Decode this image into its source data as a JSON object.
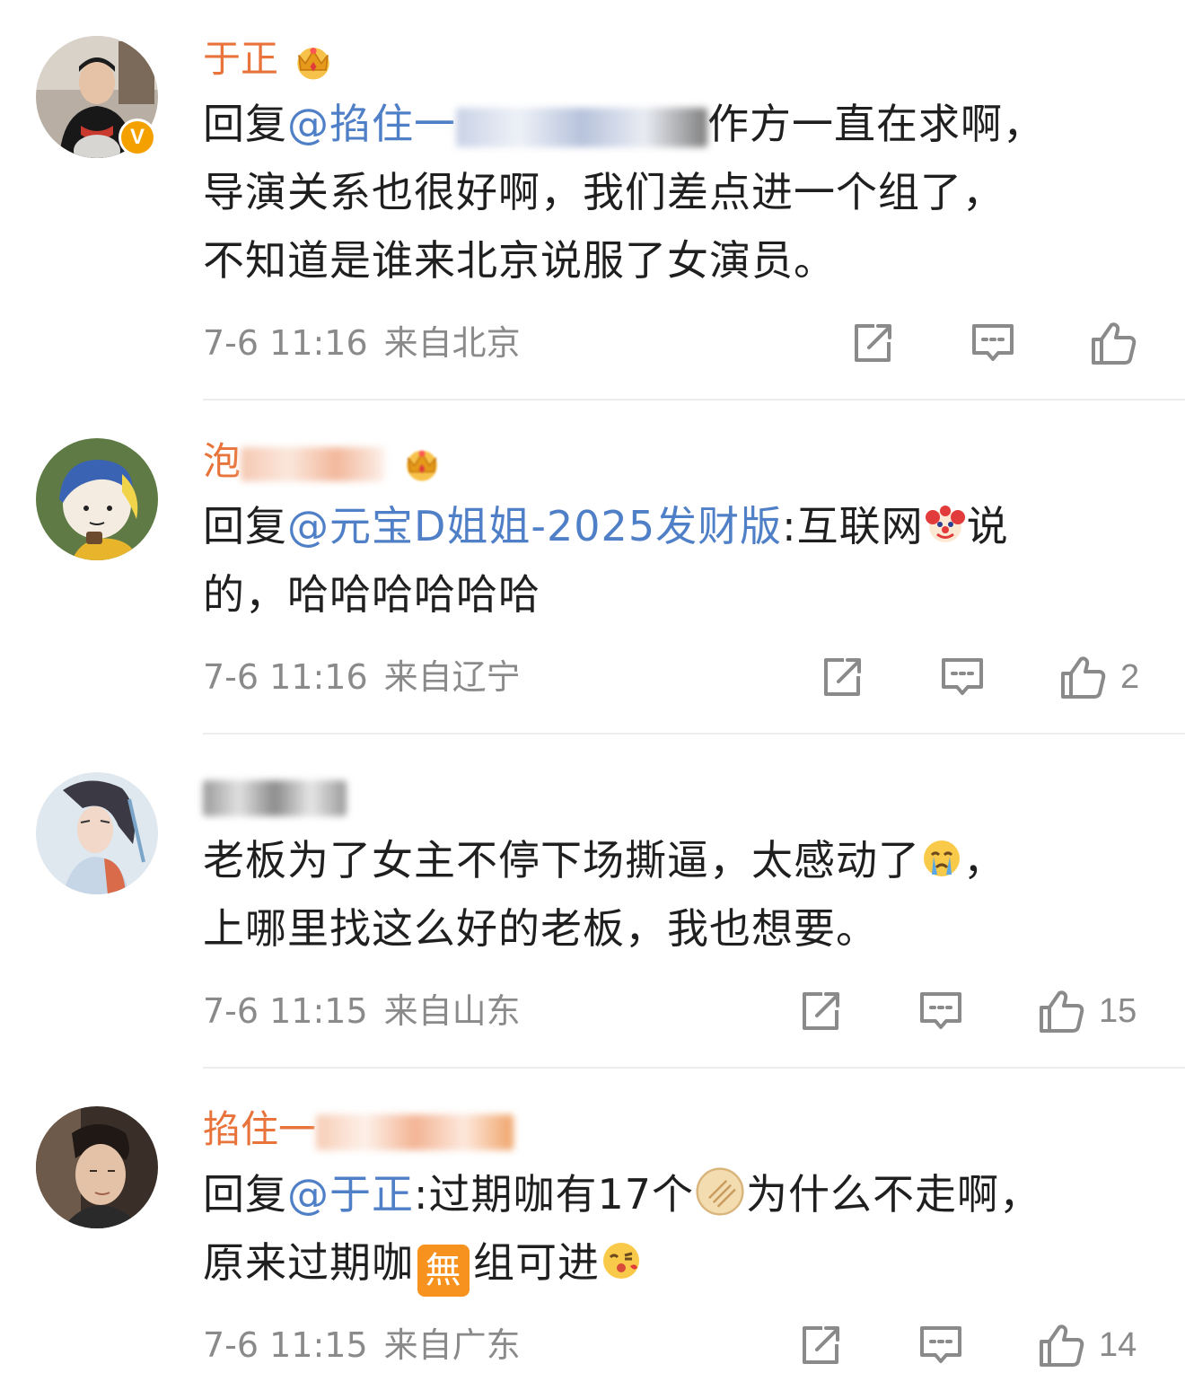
{
  "comments": [
    {
      "username": "于正",
      "line1_prefix": "回复",
      "line1_mention": "@掐住一",
      "line1_suffix": "作方一直在求啊，",
      "line2": "导演关系也很好啊，我们差点进一个组了，",
      "line3": "不知道是谁来北京说服了女演员。",
      "time": "7-6 11:16",
      "location": "来自北京",
      "likes": ""
    },
    {
      "username": "泡",
      "line1_prefix": "回复",
      "line1_mention": "@元宝D姐姐-2025发财版",
      "line1_suffix": ":互联网",
      "line1_tail": "说",
      "line2": "的，哈哈哈哈哈哈",
      "time": "7-6 11:16",
      "location": "来自辽宁",
      "likes": "2"
    },
    {
      "username": "",
      "line1": "老板为了女主不停下场撕逼，太感动了",
      "line1_tail": "，",
      "line2": "上哪里找这么好的老板，我也想要。",
      "time": "7-6 11:15",
      "location": "来自山东",
      "likes": "15"
    },
    {
      "username": "掐住一",
      "line1_prefix": "回复",
      "line1_mention": "@于正",
      "line1_suffix": ":过期咖有17个",
      "line1_tail": "为什么不走啊，",
      "line2_prefix": "原来过期咖",
      "line2_badge": "無",
      "line2_suffix": "组可进",
      "time": "7-6 11:15",
      "location": "来自广东",
      "likes": "14"
    }
  ],
  "colors": {
    "username": "#e8743b",
    "mention": "#4f7fc7",
    "meta": "#8a8a8a",
    "verified": "#f4a100"
  },
  "icons": [
    "share-icon",
    "comment-icon",
    "like-icon",
    "crown-icon",
    "clown-emoji",
    "crying-emoji",
    "cookie-emoji",
    "kiss-emoji"
  ]
}
